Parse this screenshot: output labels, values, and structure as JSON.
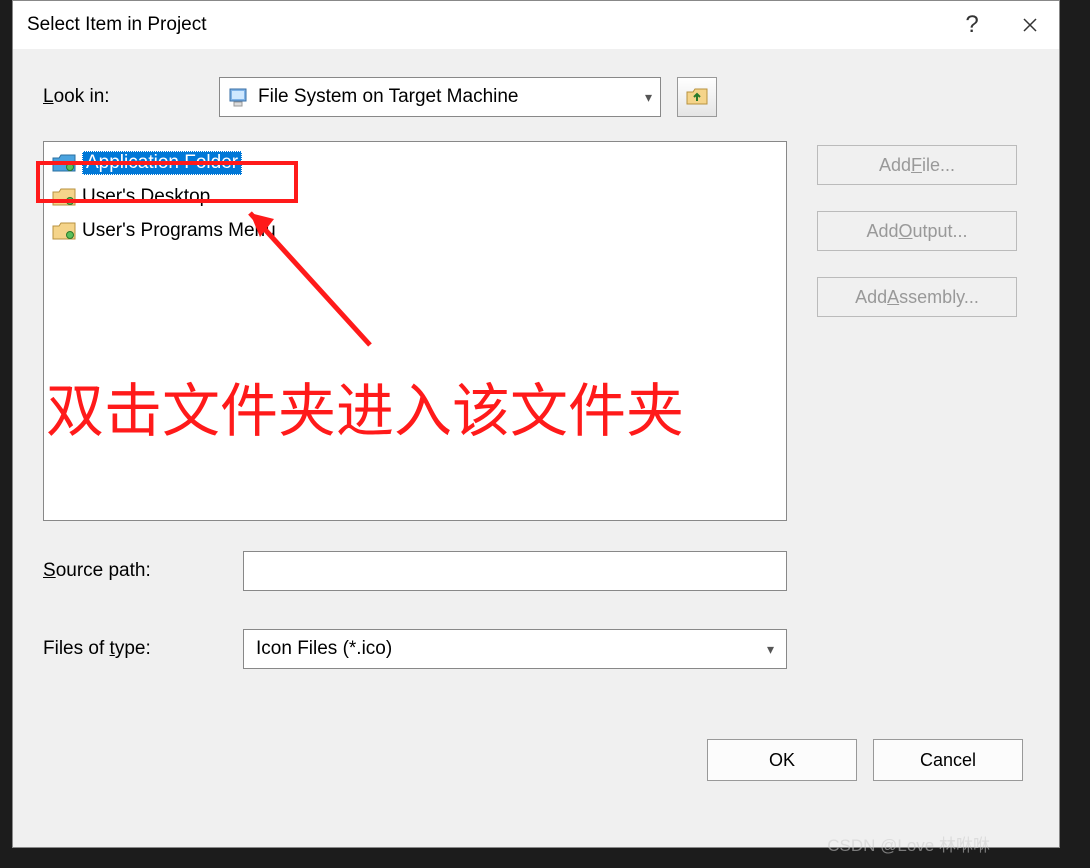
{
  "dialog": {
    "title": "Select Item in Project",
    "lookin_label": "Look in:",
    "lookin_value": "File System on Target Machine",
    "items": [
      {
        "label": "Application Folder",
        "selected": true
      },
      {
        "label": "User's Desktop",
        "selected": false
      },
      {
        "label": "User's Programs Menu",
        "selected": false
      }
    ],
    "buttons": {
      "add_file": "Add File...",
      "add_output": "Add Output...",
      "add_assembly": "Add Assembly..."
    },
    "source_path_label": "Source path:",
    "source_path_value": "",
    "files_type_label": "Files of type:",
    "files_type_value": "Icon Files (*.ico)",
    "ok": "OK",
    "cancel": "Cancel"
  },
  "annotation": {
    "text": "双击文件夹进入该文件夹"
  },
  "watermark": "CSDN @Love 林咻咻"
}
